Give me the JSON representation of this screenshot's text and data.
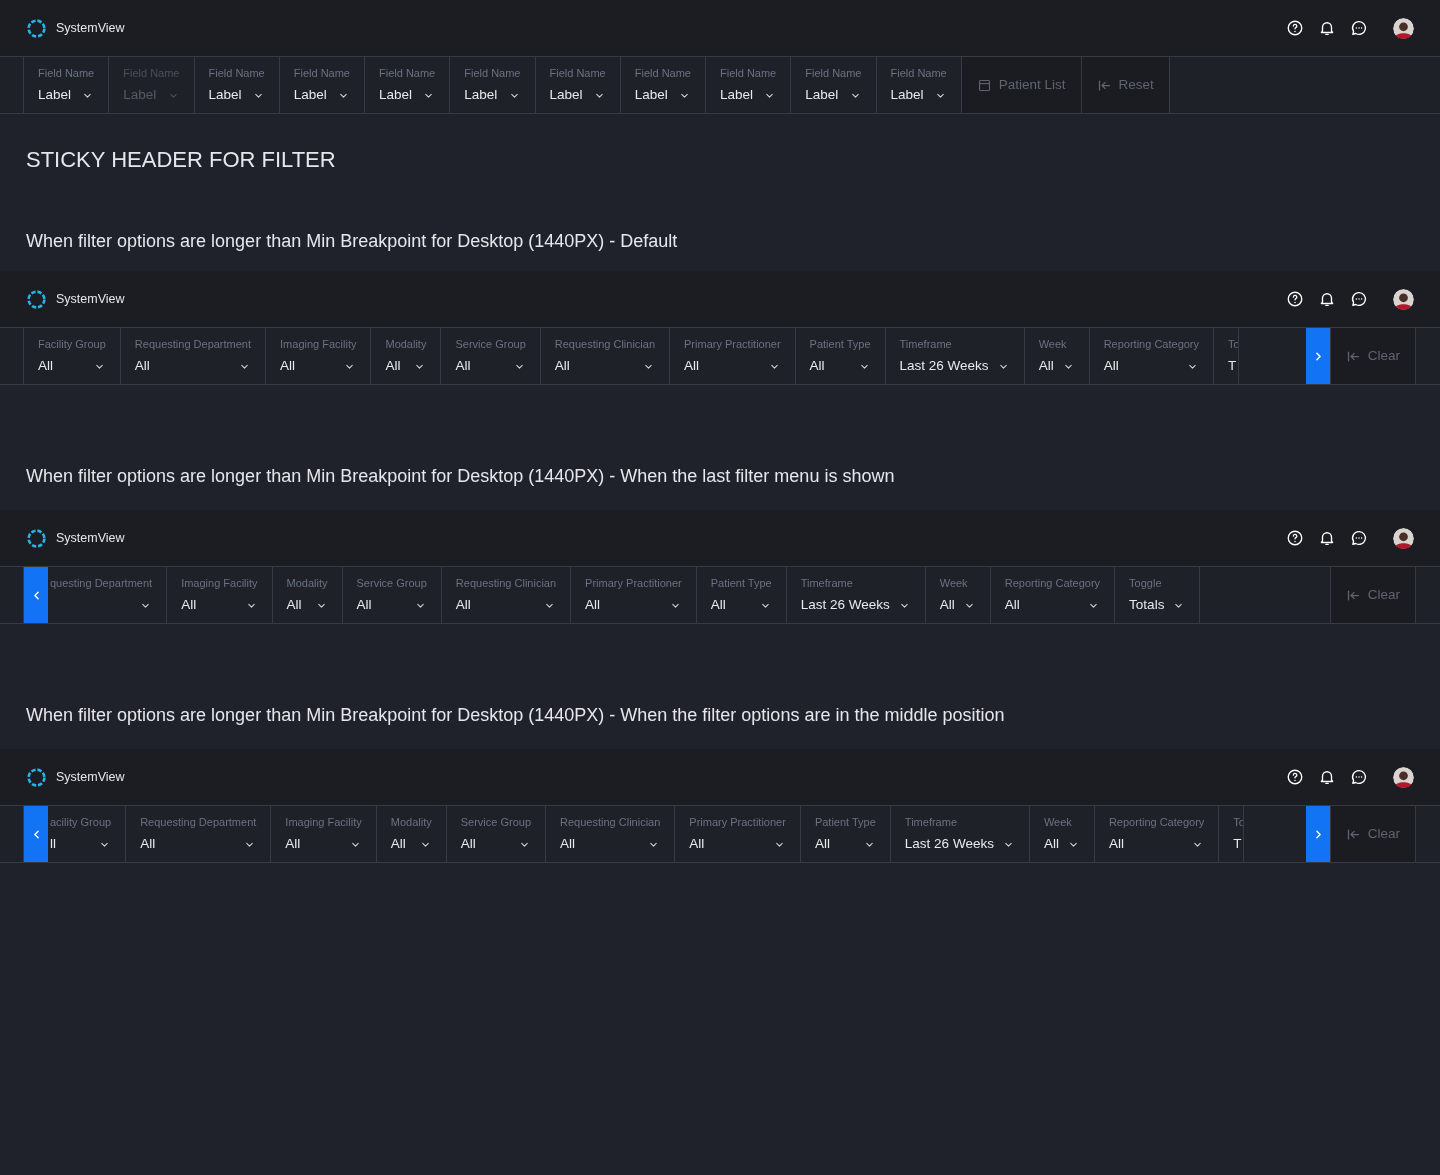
{
  "blocks": [
    {
      "kind": "app",
      "brand": "SystemView",
      "filter_bar": {
        "scroll_left": false,
        "scroll_right": false,
        "items": [
          {
            "kind": "filter",
            "label": "Field Name",
            "value": "Label",
            "disabled": false
          },
          {
            "kind": "filter",
            "label": "Field Name",
            "value": "Label",
            "disabled": true
          },
          {
            "kind": "filter",
            "label": "Field Name",
            "value": "Label",
            "disabled": false
          },
          {
            "kind": "filter",
            "label": "Field Name",
            "value": "Label",
            "disabled": false
          },
          {
            "kind": "filter",
            "label": "Field Name",
            "value": "Label",
            "disabled": false
          },
          {
            "kind": "filter",
            "label": "Field Name",
            "value": "Label",
            "disabled": false
          },
          {
            "kind": "filter",
            "label": "Field Name",
            "value": "Label",
            "disabled": false
          },
          {
            "kind": "filter",
            "label": "Field Name",
            "value": "Label",
            "disabled": false
          },
          {
            "kind": "filter",
            "label": "Field Name",
            "value": "Label",
            "disabled": false
          },
          {
            "kind": "filter",
            "label": "Field Name",
            "value": "Label",
            "disabled": false
          },
          {
            "kind": "filter",
            "label": "Field Name",
            "value": "Label",
            "disabled": false
          },
          {
            "kind": "list_action",
            "label": "Patient List"
          },
          {
            "kind": "reset_action",
            "label": "Reset"
          }
        ]
      }
    },
    {
      "kind": "title",
      "text": "STICKY HEADER FOR FILTER"
    },
    {
      "kind": "caption",
      "text": "When filter options are longer than Min Breakpoint for Desktop (1440PX) - Default"
    },
    {
      "kind": "app",
      "brand": "SystemView",
      "filter_bar": {
        "scroll_left": false,
        "scroll_right": true,
        "items": [
          {
            "kind": "filter",
            "label": "Facility Group",
            "value": "All",
            "disabled": false
          },
          {
            "kind": "filter",
            "label": "Requesting Department",
            "value": "All",
            "disabled": false
          },
          {
            "kind": "filter",
            "label": "Imaging Facility",
            "value": "All",
            "disabled": false
          },
          {
            "kind": "filter",
            "label": "Modality",
            "value": "All",
            "disabled": false
          },
          {
            "kind": "filter",
            "label": "Service Group",
            "value": "All",
            "disabled": false
          },
          {
            "kind": "filter",
            "label": "Requesting Clinician",
            "value": "All",
            "disabled": false
          },
          {
            "kind": "filter",
            "label": "Primary Practitioner",
            "value": "All",
            "disabled": false
          },
          {
            "kind": "filter",
            "label": "Patient Type",
            "value": "All",
            "disabled": false
          },
          {
            "kind": "filter",
            "label": "Timeframe",
            "value": "Last 26 Weeks",
            "disabled": false
          },
          {
            "kind": "filter",
            "label": "Week",
            "value": "All",
            "disabled": false
          },
          {
            "kind": "filter",
            "label": "Reporting Category",
            "value": "All",
            "disabled": false
          },
          {
            "kind": "partial_end",
            "label": "To",
            "value": "T",
            "disabled": false
          }
        ],
        "actions": [
          {
            "kind": "reset_action",
            "label": "Clear"
          }
        ]
      }
    },
    {
      "kind": "caption",
      "text": "When filter options are longer than Min Breakpoint for Desktop (1440PX) - When the last filter menu is shown"
    },
    {
      "kind": "app",
      "brand": "SystemView",
      "filter_bar": {
        "scroll_left": true,
        "scroll_right": false,
        "items": [
          {
            "kind": "partial_start",
            "label": "questing Department",
            "disabled": false
          },
          {
            "kind": "filter",
            "label": "Imaging Facility",
            "value": "All",
            "disabled": false
          },
          {
            "kind": "filter",
            "label": "Modality",
            "value": "All",
            "disabled": false
          },
          {
            "kind": "filter",
            "label": "Service Group",
            "value": "All",
            "disabled": false
          },
          {
            "kind": "filter",
            "label": "Requesting Clinician",
            "value": "All",
            "disabled": false
          },
          {
            "kind": "filter",
            "label": "Primary Practitioner",
            "value": "All",
            "disabled": false
          },
          {
            "kind": "filter",
            "label": "Patient Type",
            "value": "All",
            "disabled": false
          },
          {
            "kind": "filter",
            "label": "Timeframe",
            "value": "Last 26 Weeks",
            "disabled": false
          },
          {
            "kind": "filter",
            "label": "Week",
            "value": "All",
            "disabled": false
          },
          {
            "kind": "filter",
            "label": "Reporting Category",
            "value": "All",
            "disabled": false
          },
          {
            "kind": "filter",
            "label": "Toggle",
            "value": "Totals",
            "disabled": false
          }
        ],
        "actions": [
          {
            "kind": "reset_action",
            "label": "Clear"
          }
        ]
      }
    },
    {
      "kind": "caption",
      "text": "When filter options are longer than Min Breakpoint for Desktop (1440PX) - When the filter options are in the middle position"
    },
    {
      "kind": "app",
      "brand": "SystemView",
      "filter_bar": {
        "scroll_left": true,
        "scroll_right": true,
        "items": [
          {
            "kind": "partial_start",
            "label": "acility Group",
            "value": "ll",
            "disabled": false
          },
          {
            "kind": "filter",
            "label": "Requesting Department",
            "value": "All",
            "disabled": false
          },
          {
            "kind": "filter",
            "label": "Imaging Facility",
            "value": "All",
            "disabled": false
          },
          {
            "kind": "filter",
            "label": "Modality",
            "value": "All",
            "disabled": false
          },
          {
            "kind": "filter",
            "label": "Service Group",
            "value": "All",
            "disabled": false
          },
          {
            "kind": "filter",
            "label": "Requesting Clinician",
            "value": "All",
            "disabled": false
          },
          {
            "kind": "filter",
            "label": "Primary Practitioner",
            "value": "All",
            "disabled": false
          },
          {
            "kind": "filter",
            "label": "Patient Type",
            "value": "All",
            "disabled": false
          },
          {
            "kind": "filter",
            "label": "Timeframe",
            "value": "Last 26 Weeks",
            "disabled": false
          },
          {
            "kind": "filter",
            "label": "Week",
            "value": "All",
            "disabled": false
          },
          {
            "kind": "filter",
            "label": "Reporting Category",
            "value": "All",
            "disabled": false
          },
          {
            "kind": "partial_end",
            "label": "To",
            "value": "T",
            "disabled": false
          }
        ],
        "actions": [
          {
            "kind": "reset_action",
            "label": "Clear"
          }
        ]
      }
    }
  ]
}
